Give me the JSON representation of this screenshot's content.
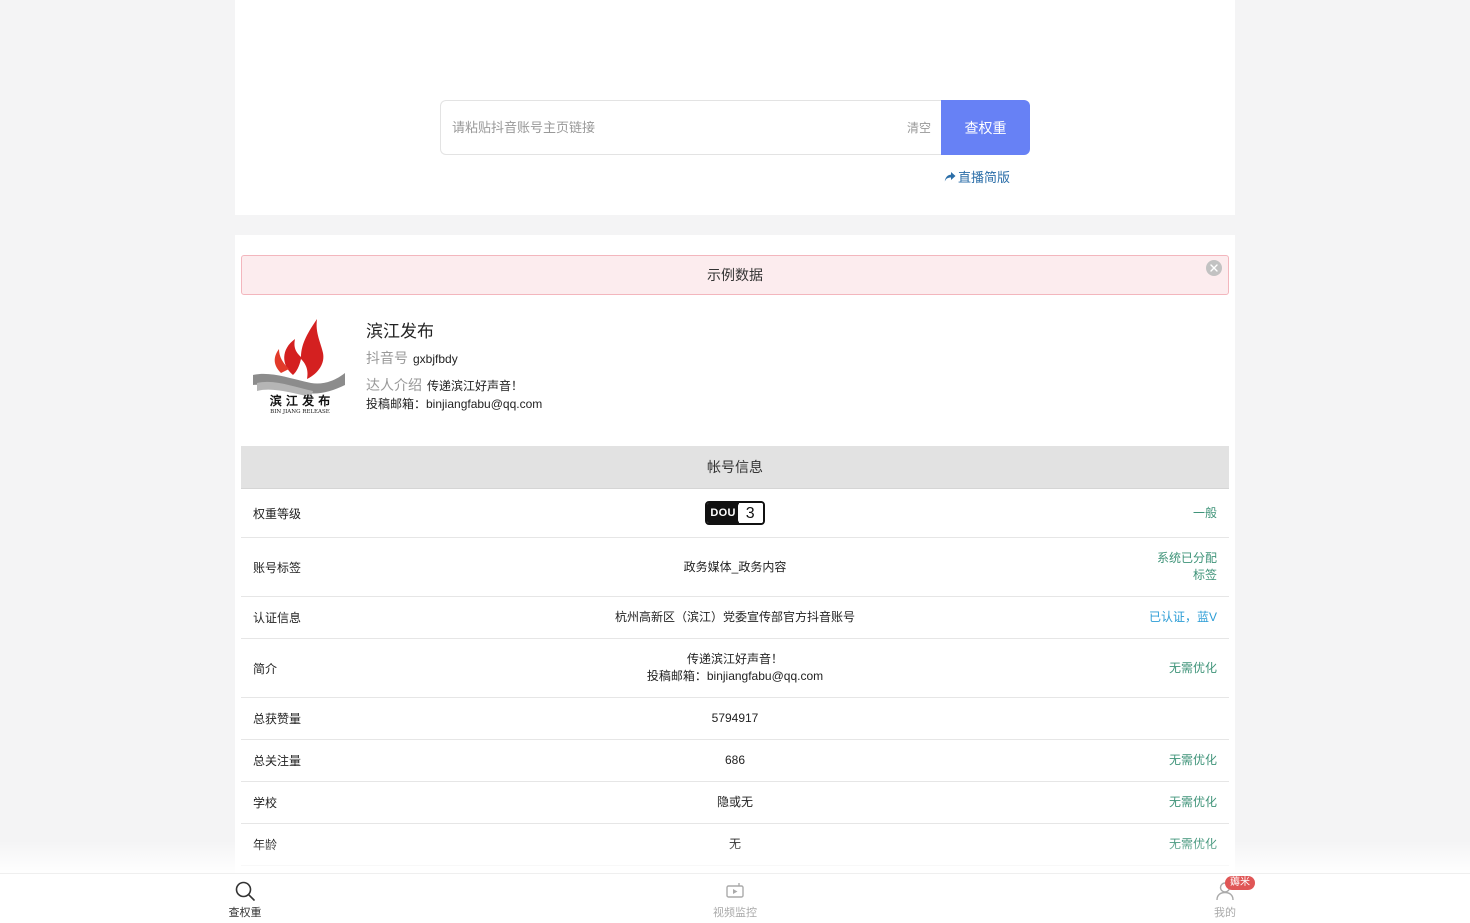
{
  "search": {
    "placeholder": "请粘贴抖音账号主页链接",
    "clear_label": "清空",
    "query_label": "查权重",
    "live_link_label": "直播简版"
  },
  "banner": {
    "text": "示例数据"
  },
  "profile": {
    "name": "滨江发布",
    "douyin_id_label": "抖音号",
    "douyin_id": "gxbjfbdy",
    "intro_label": "达人介绍",
    "intro_line1": "传递滨江好声音！",
    "intro_line2": "投稿邮箱：binjiangfabu@qq.com",
    "logo_text_cn": "滨 江 发 布",
    "logo_text_en": "BIN JIANG RELEASE"
  },
  "account_table": {
    "title": "帐号信息",
    "rows": [
      {
        "label": "权重等级",
        "badge_text": "DOU",
        "badge_level": "3",
        "status": "一般"
      },
      {
        "label": "账号标签",
        "value": "政务媒体_政务内容",
        "status_line1": "系统已分配",
        "status_line2": "标签"
      },
      {
        "label": "认证信息",
        "value": "杭州高新区（滨江）党委宣传部官方抖音账号",
        "status": "已认证，蓝V"
      },
      {
        "label": "简介",
        "value_line1": "传递滨江好声音！",
        "value_line2": "投稿邮箱：binjiangfabu@qq.com",
        "status": "无需优化"
      },
      {
        "label": "总获赞量",
        "value": "5794917",
        "status": ""
      },
      {
        "label": "总关注量",
        "value": "686",
        "status": "无需优化"
      },
      {
        "label": "学校",
        "value": "隐或无",
        "status": "无需优化"
      },
      {
        "label": "年龄",
        "value": "无",
        "status": "无需优化"
      }
    ]
  },
  "tabbar": {
    "tabs": [
      {
        "label": "查权重",
        "icon": "search-icon"
      },
      {
        "label": "视频监控",
        "icon": "video-monitor-icon"
      },
      {
        "label": "我的",
        "icon": "user-icon"
      }
    ],
    "badge": "薅米"
  },
  "colors": {
    "accent": "#6781f5",
    "status_green": "#3e9378",
    "status_blue": "#2c9dd6",
    "banner_bg": "#fcecee",
    "badge_red": "#e05656"
  }
}
